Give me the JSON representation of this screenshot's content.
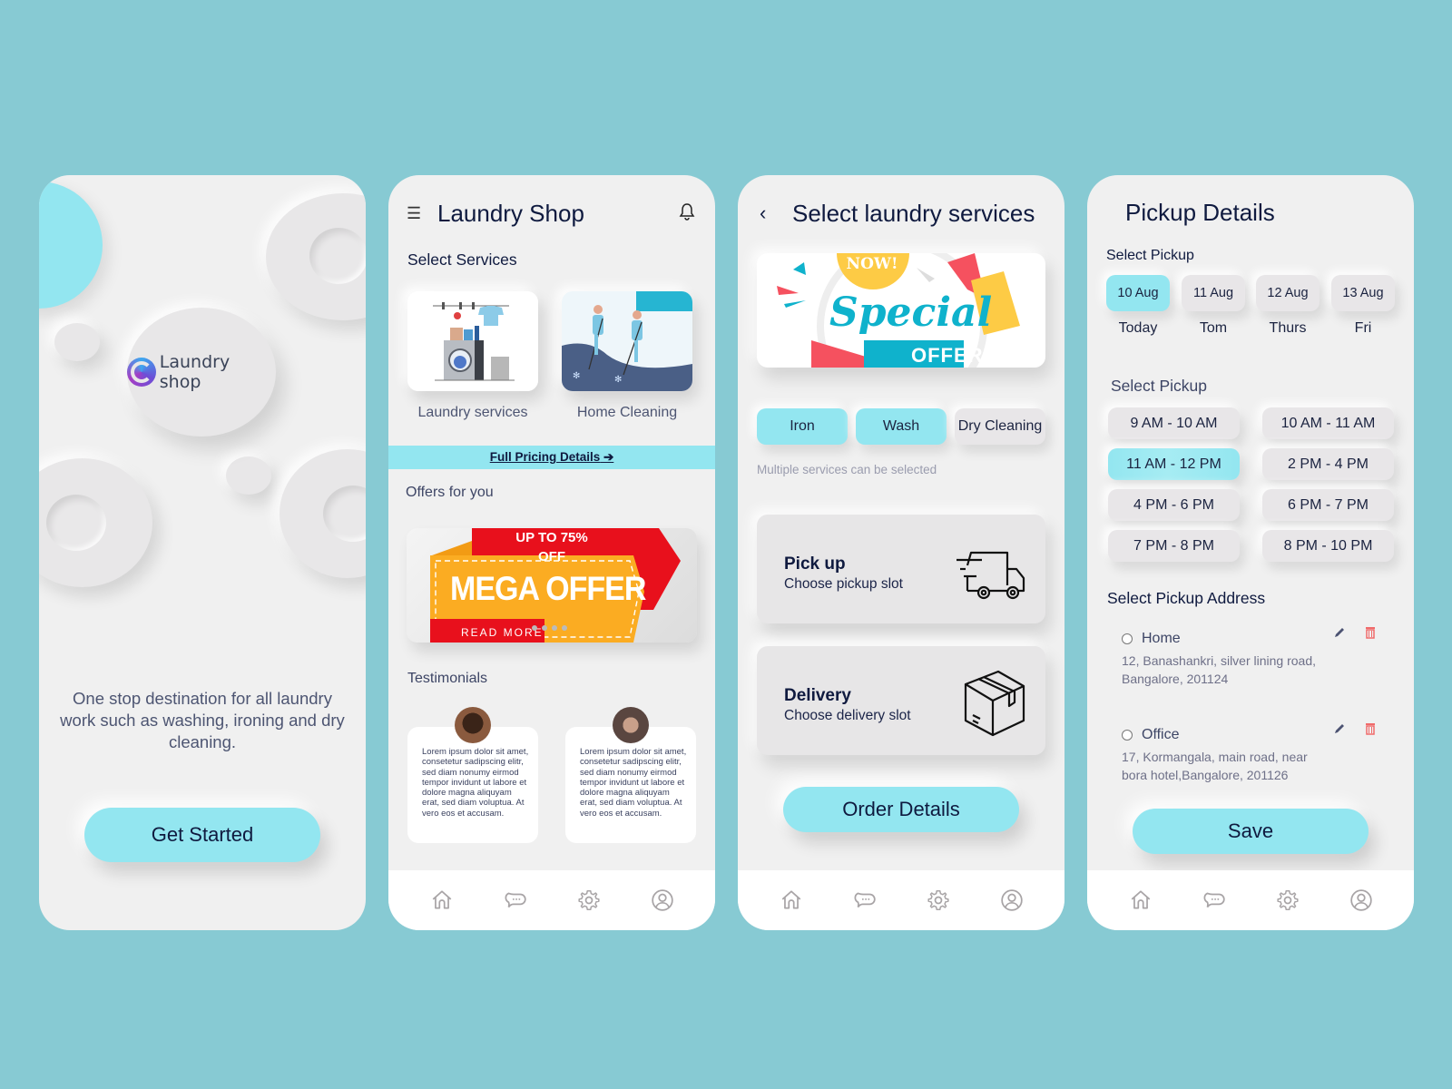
{
  "colors": {
    "background": "#87cad3",
    "accent": "#93e6f0",
    "text_dark": "#0f1a3f",
    "delete": "#f06a6a"
  },
  "splash": {
    "logo_text": "Laundry shop",
    "tagline": "One stop destination for all laundry work such as washing, ironing and dry cleaning.",
    "cta_label": "Get Started"
  },
  "home": {
    "title": "Laundry Shop",
    "menu_icon": "hamburger-icon",
    "notification_icon": "bell-icon",
    "services_heading": "Select Services",
    "services": [
      {
        "label": "Laundry services",
        "image": "laundry-illustration"
      },
      {
        "label": "Home Cleaning",
        "image": "cleaning-illustration"
      }
    ],
    "pricing_link": "Full Pricing Details",
    "offers_heading": "Offers for you",
    "offer_banner": {
      "top_text": "UP TO 75% OFF",
      "main_text": "MEGA OFFER",
      "cta_text": "READ MORE",
      "carousel_dots": 4
    },
    "testimonials_heading": "Testimonials",
    "testimonials": [
      {
        "text": "Lorem ipsum dolor sit amet, consetetur sadipscing elitr, sed diam nonumy eirmod tempor invidunt ut labore et dolore magna aliquyam erat, sed diam voluptua. At vero eos et accusam."
      },
      {
        "text": "Lorem ipsum dolor sit amet, consetetur sadipscing elitr, sed diam nonumy eirmod tempor invidunt ut labore et dolore magna aliquyam erat, sed diam voluptua. At vero eos et accusam."
      }
    ]
  },
  "services_page": {
    "title": "Select laundry services",
    "banner": {
      "top_text": "NOW!",
      "main_text": "Special",
      "bottom_text": "OFFER"
    },
    "chips": [
      {
        "label": "Iron",
        "selected": true
      },
      {
        "label": "Wash",
        "selected": true
      },
      {
        "label": "Dry Cleaning",
        "selected": false
      }
    ],
    "hint": "Multiple services can be selected",
    "pickup": {
      "title": "Pick up",
      "subtitle": "Choose pickup slot",
      "icon": "truck-icon"
    },
    "delivery": {
      "title": "Delivery",
      "subtitle": "Choose delivery slot",
      "icon": "box-icon"
    },
    "cta_label": "Order Details"
  },
  "pickup_page": {
    "title": "Pickup Details",
    "date_heading": "Select Pickup",
    "dates": [
      {
        "date": "10 Aug",
        "day": "Today",
        "selected": true
      },
      {
        "date": "11 Aug",
        "day": "Tom",
        "selected": false
      },
      {
        "date": "12 Aug",
        "day": "Thurs",
        "selected": false
      },
      {
        "date": "13 Aug",
        "day": "Fri",
        "selected": false
      }
    ],
    "time_heading": "Select Pickup",
    "times": [
      {
        "label": "9 AM - 10 AM",
        "selected": false
      },
      {
        "label": "10 AM - 11 AM",
        "selected": false
      },
      {
        "label": "11 AM - 12 PM",
        "selected": true
      },
      {
        "label": "2 PM - 4 PM",
        "selected": false
      },
      {
        "label": "4 PM - 6 PM",
        "selected": false
      },
      {
        "label": "6 PM - 7 PM",
        "selected": false
      },
      {
        "label": "7 PM - 8 PM",
        "selected": false
      },
      {
        "label": "8 PM - 10 PM",
        "selected": false
      }
    ],
    "address_heading": "Select Pickup Address",
    "addresses": [
      {
        "name": "Home",
        "address": "12, Banashankri, silver lining road, Bangalore, 201124"
      },
      {
        "name": "Office",
        "address": "17, Kormangala, main road, near bora hotel,Bangalore, 201126"
      }
    ],
    "cta_label": "Save"
  },
  "bottom_nav": [
    {
      "icon": "home-icon"
    },
    {
      "icon": "chat-icon"
    },
    {
      "icon": "settings-icon"
    },
    {
      "icon": "profile-icon"
    }
  ]
}
